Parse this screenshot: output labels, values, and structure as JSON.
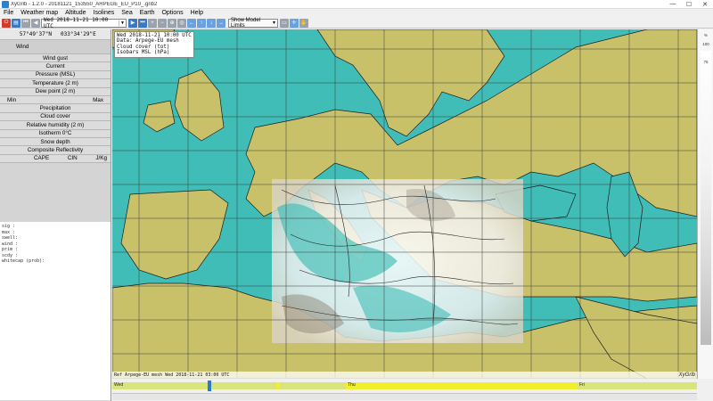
{
  "window": {
    "title": "XyGrib - 1.2.0 - 20181121_153550_ARPEGE_EU_P10_.grib2",
    "minimize": "—",
    "maximize": "☐",
    "close": "✕"
  },
  "menu": [
    "File",
    "Weather map",
    "Altitude",
    "Isolines",
    "Sea",
    "Earth",
    "Options",
    "Help"
  ],
  "toolbar": {
    "date_value": "Wed 2018-11-21 10:00 UTC",
    "model_limits_label": "Show Model Limits"
  },
  "left_panel": {
    "latitude": "57°49'37\"N",
    "longitude": "033°34'29\"E",
    "wind_label": "Wind",
    "wind_gust_label": "Wind gust",
    "current_label": "Current",
    "pressure_label": "Pressure (MSL)",
    "temperature_label": "Temperature (2 m)",
    "dewpoint_label": "Dew point (2 m)",
    "min_label": "Min",
    "max_label": "Max",
    "precip_label": "Precipitation",
    "cloud_label": "Cloud cover",
    "humidity_label": "Relative humidity (2 m)",
    "isotherm_label": "Isotherm 0°C",
    "snow_label": "Snow depth",
    "reflectivity_label": "Composite Reflectivity",
    "cape_label": "CAPE",
    "cin_label": "CIN",
    "jkg_label": "J/Kg"
  },
  "left_info": {
    "sig": "sig :",
    "max": "max :",
    "swell": "swell:",
    "wind": "wind :",
    "prim": "prim :",
    "scdy": "scdy :",
    "whitecap": "whitecap (prob):"
  },
  "map": {
    "label_date": "Wed 2018-11-21 10:00 UTC",
    "label_data": "Data: Arpege-EU mesh",
    "label_cloud": "Cloud cover (tot)",
    "label_isobars": "Isobars MSL (hPa)",
    "footer": "Ref Arpege-EU mesh   Wed 2018-11-21 03:00 UTC",
    "brand": "XyGrib"
  },
  "scale": {
    "top": "%",
    "t100": "100",
    "t75": "75"
  },
  "timeline": {
    "day1": "Wed",
    "day2": "Thu",
    "day3": "Fri"
  },
  "colors": {
    "sea": "#3fbdb6",
    "land": "#c8c16a",
    "grid": "#3b3b3b"
  }
}
